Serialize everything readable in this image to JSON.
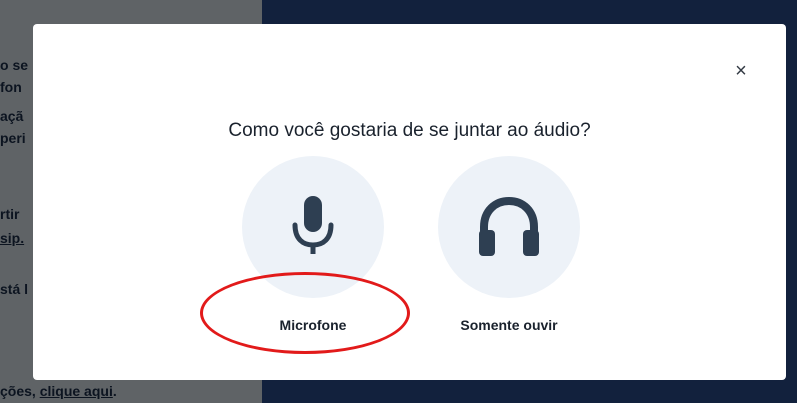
{
  "left_panel": {
    "fragments": [
      "o se",
      "fon",
      "açã",
      "peri",
      "rtir",
      "sip.",
      "stá l"
    ],
    "footer_text": "ções, ",
    "footer_link": "clique aqui",
    "footer_end": "."
  },
  "modal": {
    "close_glyph": "×",
    "question": "Como você gostaria de se juntar ao áudio?",
    "options": [
      {
        "label": "Microfone",
        "icon": "microphone-icon"
      },
      {
        "label": "Somente ouvir",
        "icon": "headphones-icon"
      }
    ]
  },
  "colors": {
    "icon": "#2e3f52",
    "circle": "#edf2f8",
    "annotation": "#e21a1a",
    "backdrop_dark": "#12213d",
    "backdrop_gray": "#5f6366"
  }
}
